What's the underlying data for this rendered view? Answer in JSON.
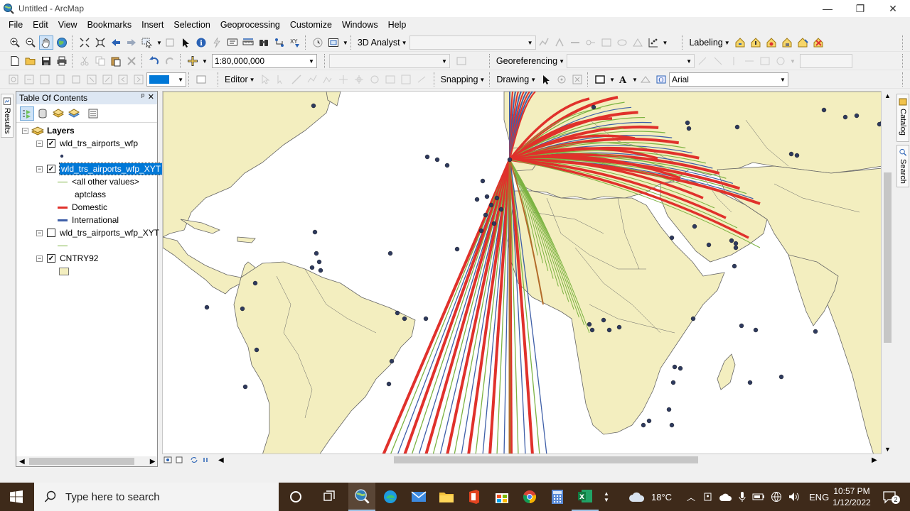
{
  "window": {
    "title": "Untitled - ArcMap",
    "minimize": "—",
    "maximize": "❐",
    "close": "✕"
  },
  "menu": [
    "File",
    "Edit",
    "View",
    "Bookmarks",
    "Insert",
    "Selection",
    "Geoprocessing",
    "Customize",
    "Windows",
    "Help"
  ],
  "toolbar1": {
    "analyst_label": "3D Analyst",
    "analyst_layer": "",
    "labeling_label": "Labeling"
  },
  "toolbar2": {
    "scale": "1:80,000,000",
    "georef_label": "Georeferencing",
    "georef_layer": ""
  },
  "toolbar3": {
    "editor_label": "Editor",
    "snapping_label": "Snapping",
    "drawing_label": "Drawing",
    "font": "Arial"
  },
  "left_tabs": {
    "results": "Results"
  },
  "right_tabs": {
    "catalog": "Catalog",
    "search": "Search"
  },
  "toc": {
    "title": "Table Of Contents",
    "pin": "ᵖ",
    "close": "✕",
    "root": "Layers",
    "layers": [
      {
        "name": "wld_trs_airports_wfp",
        "checked": true
      },
      {
        "name": "wld_trs_airports_wfp_XYT",
        "checked": true,
        "selected": true,
        "legend": [
          {
            "label": "<all other values>",
            "color": "#7cb342"
          },
          {
            "label": "aptclass"
          },
          {
            "label": "Domestic",
            "color": "#e0312b"
          },
          {
            "label": "International",
            "color": "#3f5fa8"
          }
        ]
      },
      {
        "name": "wld_trs_airports_wfp_XYT",
        "checked": false,
        "legend_color": "#7cb342"
      },
      {
        "name": "CNTRY92",
        "checked": true,
        "fill": "#f3eebf"
      }
    ]
  },
  "map": {
    "land_color": "#f3eebf",
    "sea_color": "#ffffff",
    "border_color": "#555555",
    "airport_color": "#2e3a5e"
  },
  "taskbar": {
    "search_placeholder": "Type here to search",
    "weather": "18°C",
    "language": "ENG",
    "time": "10:57 PM",
    "date": "1/12/2022",
    "notif_count": "2"
  }
}
